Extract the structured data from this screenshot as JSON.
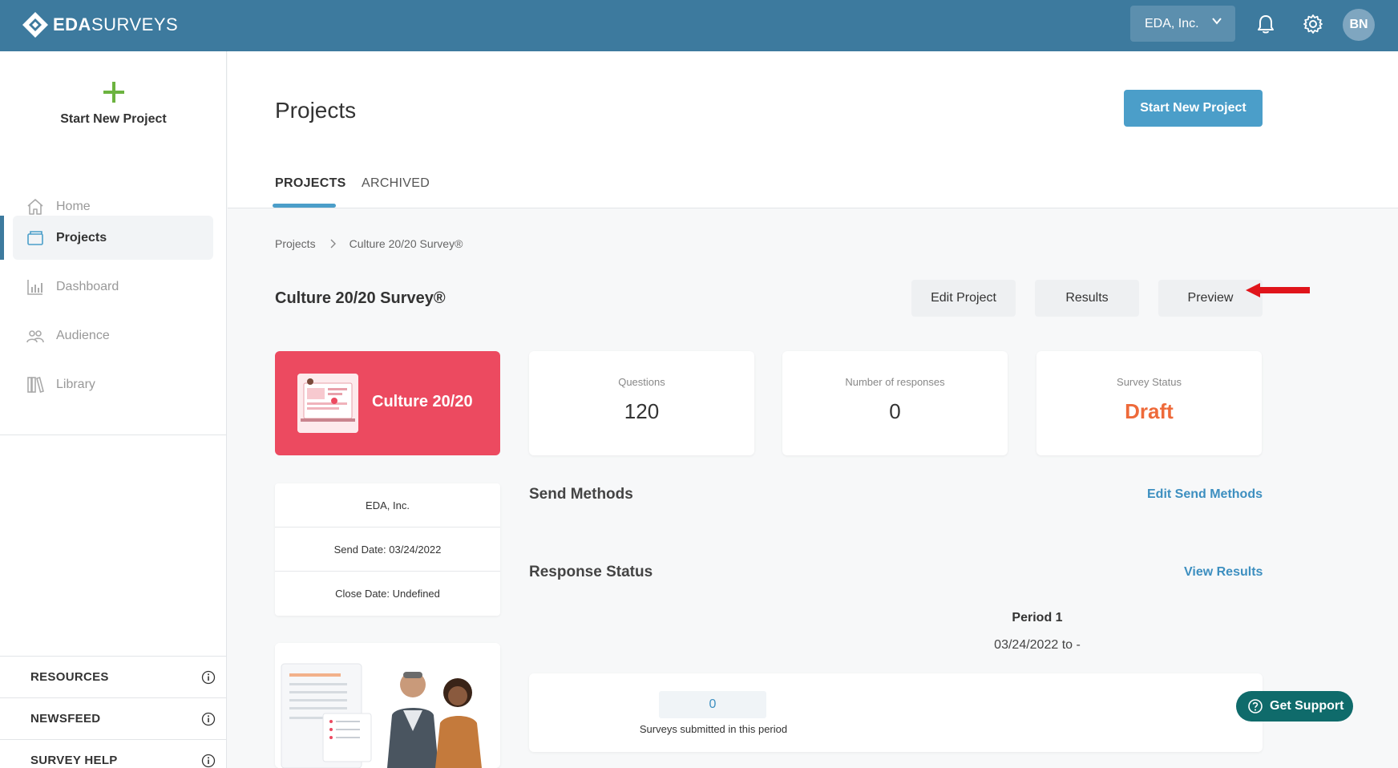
{
  "app": {
    "logo_bold": "EDA",
    "logo_light": "SURVEYS",
    "company_selector": "EDA, Inc.",
    "user_initials": "BN",
    "accent_color": "#3d7a9e"
  },
  "sidebar": {
    "start_new_label": "Start New Project",
    "items": [
      {
        "label": "Home",
        "icon": "home-icon",
        "active": false
      },
      {
        "label": "Projects",
        "icon": "folder-icon",
        "active": true
      },
      {
        "label": "Dashboard",
        "icon": "bar-chart-icon",
        "active": false
      },
      {
        "label": "Audience",
        "icon": "people-icon",
        "active": false
      },
      {
        "label": "Library",
        "icon": "library-icon",
        "active": false
      }
    ],
    "sections": [
      {
        "label": "RESOURCES"
      },
      {
        "label": "NEWSFEED"
      },
      {
        "label": "SURVEY HELP"
      }
    ]
  },
  "page": {
    "title": "Projects",
    "start_new_button": "Start New Project",
    "tabs": [
      {
        "label": "PROJECTS",
        "active": true
      },
      {
        "label": "ARCHIVED",
        "active": false
      }
    ],
    "breadcrumb": [
      "Projects",
      "Culture 20/20 Survey®"
    ]
  },
  "project": {
    "title": "Culture 20/20 Survey®",
    "actions": {
      "edit": "Edit Project",
      "results": "Results",
      "preview": "Preview"
    },
    "card_label": "Culture 20/20",
    "stats": [
      {
        "label": "Questions",
        "value": "120"
      },
      {
        "label": "Number of responses",
        "value": "0"
      },
      {
        "label": "Survey Status",
        "value": "Draft"
      }
    ],
    "info": {
      "company": "EDA, Inc.",
      "send_date": "Send Date: 03/24/2022",
      "close_date": "Close Date: Undefined"
    },
    "send_methods": {
      "title": "Send Methods",
      "link": "Edit Send Methods"
    },
    "response_status": {
      "title": "Response Status",
      "link": "View Results",
      "period_title": "Period 1",
      "period_range": "03/24/2022 to -",
      "count": "0",
      "count_label": "Surveys submitted in this period"
    }
  },
  "support": {
    "label": "Get Support"
  }
}
